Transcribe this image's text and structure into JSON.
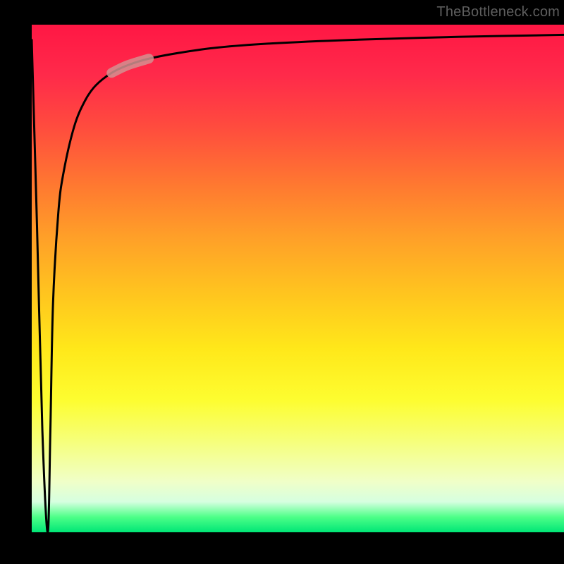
{
  "attribution": "TheBottleneck.com",
  "chart_data": {
    "type": "line",
    "title": "",
    "xlabel": "",
    "ylabel": "",
    "xlim": [
      0,
      100
    ],
    "ylim": [
      0,
      100
    ],
    "series": [
      {
        "name": "bottleneck-curve",
        "x": [
          0,
          1,
          2,
          3,
          3.5,
          4,
          5,
          6,
          8,
          10,
          12,
          15,
          18,
          22,
          28,
          35,
          45,
          60,
          80,
          100
        ],
        "y": [
          97,
          60,
          20,
          0,
          20,
          45,
          63,
          71,
          80,
          85,
          88,
          90.5,
          92,
          93.3,
          94.5,
          95.5,
          96.3,
          97,
          97.6,
          98
        ]
      }
    ],
    "highlight_segment": {
      "series": "bottleneck-curve",
      "x_start": 15,
      "x_end": 22,
      "color": "#d49090"
    },
    "gradient_stops": [
      {
        "pos": 0.0,
        "color": "#ff1744"
      },
      {
        "pos": 0.2,
        "color": "#ff4b3e"
      },
      {
        "pos": 0.42,
        "color": "#ffa028"
      },
      {
        "pos": 0.64,
        "color": "#ffe81a"
      },
      {
        "pos": 0.82,
        "color": "#f6ff7a"
      },
      {
        "pos": 0.94,
        "color": "#d6ffe0"
      },
      {
        "pos": 1.0,
        "color": "#00e676"
      }
    ]
  }
}
